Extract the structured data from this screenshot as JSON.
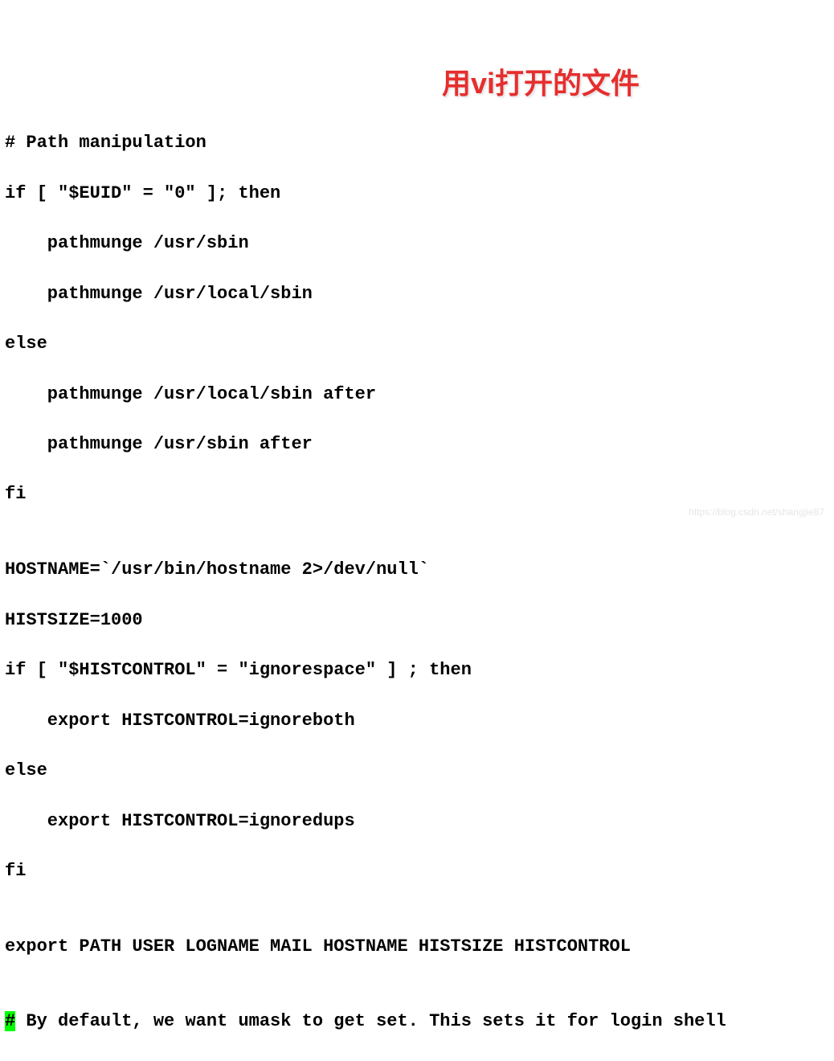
{
  "editor": {
    "lines": [
      "# Path manipulation",
      "if [ \"$EUID\" = \"0\" ]; then",
      "    pathmunge /usr/sbin",
      "    pathmunge /usr/local/sbin",
      "else",
      "    pathmunge /usr/local/sbin after",
      "    pathmunge /usr/sbin after",
      "fi",
      "",
      "HOSTNAME=`/usr/bin/hostname 2>/dev/null`",
      "HISTSIZE=1000",
      "if [ \"$HISTCONTROL\" = \"ignorespace\" ] ; then",
      "    export HISTCONTROL=ignoreboth",
      "else",
      "    export HISTCONTROL=ignoredups",
      "fi",
      "",
      "export PATH USER LOGNAME MAIL HOSTNAME HISTSIZE HISTCONTROL",
      ""
    ],
    "cursor_line_prefix": "#",
    "cursor_line_rest": " By default, we want umask to get set. This sets it for login shell",
    "text_cursor_line_index": 2,
    "text_cursor_col": 10
  },
  "annotation": {
    "text": "用vi打开的文件"
  },
  "watermark": {
    "text": "https://blog.csdn.net/shangjie87"
  }
}
